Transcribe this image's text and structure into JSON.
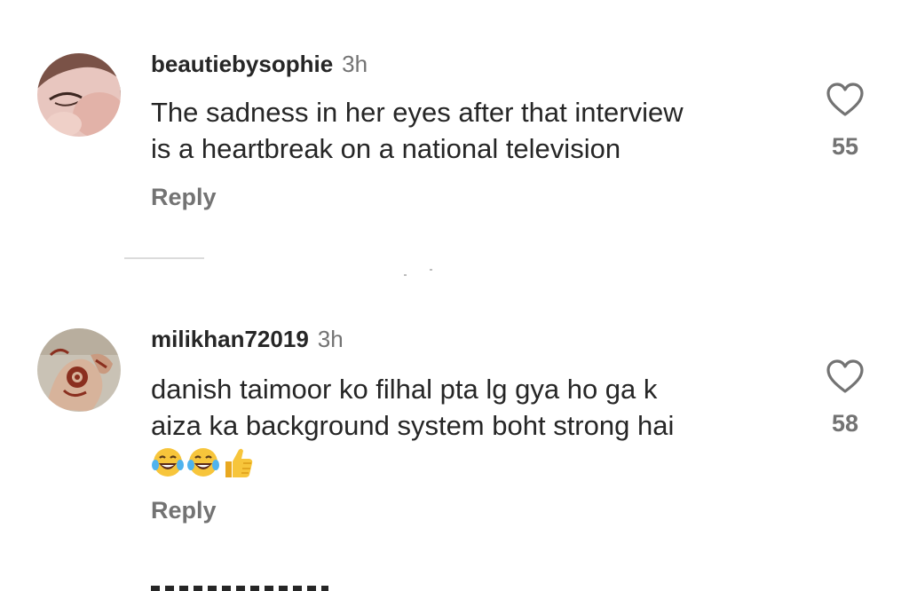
{
  "comments": [
    {
      "username": "beautiebysophie",
      "time": "3h",
      "lines": [
        "The sadness in her eyes after that interview",
        "is a heartbreak on a national television"
      ],
      "reply_label": "Reply",
      "likes": "55",
      "avatar_icon": "profile-photo"
    },
    {
      "username": "milikhan72019",
      "time": "3h",
      "lines": [
        "danish taimoor ko filhal pta lg gya ho ga k",
        "aiza ka background system boht strong hai"
      ],
      "emojis": [
        "face-with-tears-of-joy",
        "face-with-tears-of-joy",
        "thumbs-up"
      ],
      "reply_label": "Reply",
      "likes": "58",
      "avatar_icon": "henna-hands-photo"
    }
  ],
  "colors": {
    "primary_text": "#262626",
    "secondary_text": "#737373",
    "divider": "#dbdbdb"
  },
  "icons": {
    "like": "heart-outline-icon"
  }
}
